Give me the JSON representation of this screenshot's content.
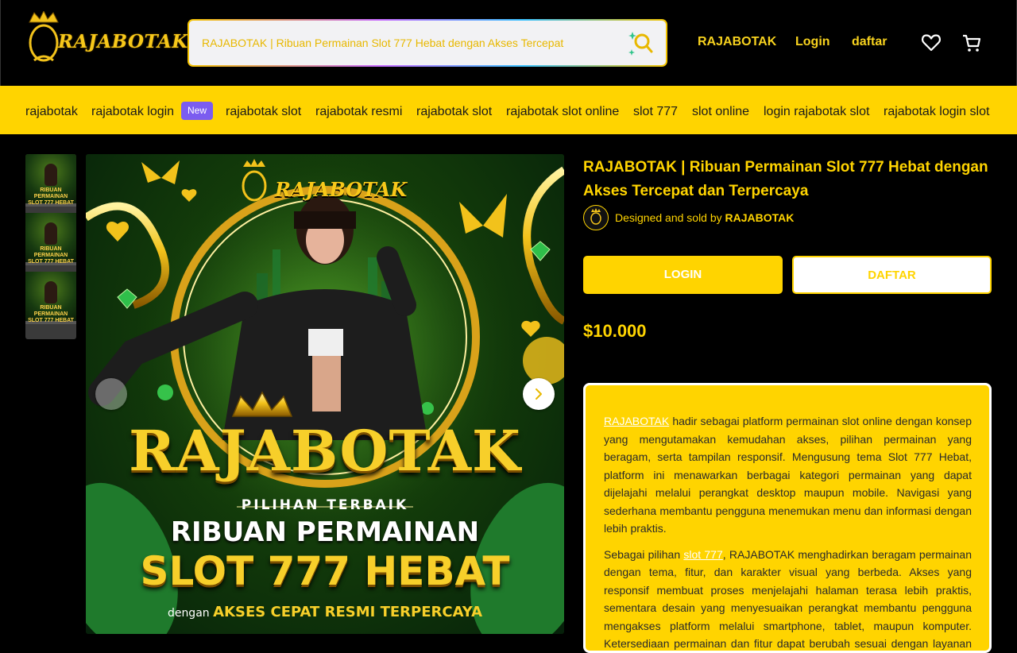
{
  "header": {
    "logo_text": "RAJABOTAK",
    "search_placeholder": "RAJABOTAK | Ribuan Permainan Slot 777 Hebat dengan Akses Tercepat",
    "nav": [
      "RAJABOTAK",
      "Login",
      "daftar"
    ],
    "icons": [
      "heart-icon",
      "cart-icon",
      "search-icon"
    ]
  },
  "categories": {
    "items": [
      "rajabotak",
      "rajabotak login",
      "rajabotak slot",
      "rajabotak resmi",
      "rajabotak slot",
      "rajabotak slot online",
      "slot 777",
      "slot online",
      "login rajabotak slot",
      "rajabotak login slot"
    ],
    "new_badge": "New"
  },
  "gallery": {
    "thumb_text": "RIBUAN PERMAINAN SLOT 777 HEBAT",
    "hero": {
      "logo": "RAJABOTAK",
      "big_title": "RAJABOTAK",
      "tagline": "PILIHAN TERBAIK",
      "line1": "RIBUAN PERMAINAN",
      "line2": "SLOT 777 HEBAT",
      "line3_prefix": "dengan",
      "line3": "AKSES CEPAT RESMI TERPERCAYA"
    }
  },
  "product": {
    "title": "RAJABOTAK | Ribuan Permainan Slot 777 Hebat dengan Akses Tercepat dan Terpercaya",
    "seller_prefix": "Designed and sold by",
    "seller_name": "RAJABOTAK",
    "login_label": "LOGIN",
    "daftar_label": "DAFTAR",
    "price": "$10.000",
    "desc_p1_link": "RAJABOTAK",
    "desc_p1": " hadir sebagai platform permainan slot online dengan konsep yang mengutamakan kemudahan akses, pilihan permainan yang beragam, serta tampilan responsif. Mengusung tema Slot 777 Hebat, platform ini menawarkan berbagai kategori permainan yang dapat dijelajahi melalui perangkat desktop maupun mobile. Navigasi yang sederhana membantu pengguna menemukan menu dan informasi dengan lebih praktis.",
    "desc_p2_prefix": "Sebagai pilihan ",
    "desc_p2_link": "slot 777",
    "desc_p2": ", RAJABOTAK menghadirkan beragam permainan dengan tema, fitur, dan karakter visual yang berbeda. Akses yang responsif membuat proses menjelajahi halaman terasa lebih praktis, sementara desain yang menyesuaikan perangkat membantu pengguna mengakses platform melalui smartphone, tablet, maupun komputer. Ketersediaan permainan dan fitur dapat berubah sesuai dengan layanan yang"
  },
  "colors": {
    "accent": "#ffd400",
    "badge": "#7b5cf0",
    "background": "#000000"
  }
}
